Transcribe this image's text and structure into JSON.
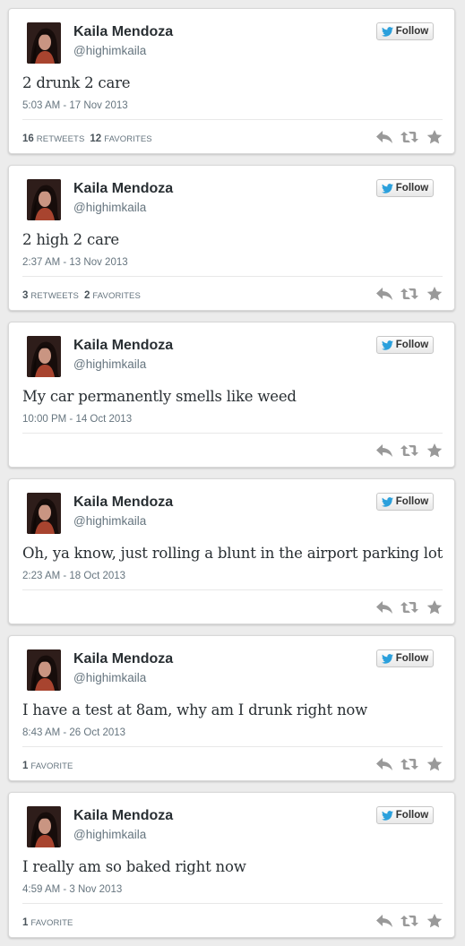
{
  "colors": {
    "page_background": "#ececec",
    "card_background": "#ffffff",
    "twitter_blue": "#2ba0dc",
    "action_icon_gray": "#999999"
  },
  "tweets": [
    {
      "display_name": "Kaila Mendoza",
      "handle": "@highimkaila",
      "follow_label": "Follow",
      "text": "2 drunk 2 care",
      "timestamp": "5:03 AM - 17 Nov 2013",
      "stats": [
        {
          "count": "16",
          "label": "RETWEETS"
        },
        {
          "count": "12",
          "label": "FAVORITES"
        }
      ]
    },
    {
      "display_name": "Kaila Mendoza",
      "handle": "@highimkaila",
      "follow_label": "Follow",
      "text": "2 high 2 care",
      "timestamp": "2:37 AM - 13 Nov 2013",
      "stats": [
        {
          "count": "3",
          "label": "RETWEETS"
        },
        {
          "count": "2",
          "label": "FAVORITES"
        }
      ]
    },
    {
      "display_name": "Kaila Mendoza",
      "handle": "@highimkaila",
      "follow_label": "Follow",
      "text": "My car permanently smells like weed",
      "timestamp": "10:00 PM - 14 Oct 2013",
      "stats": []
    },
    {
      "display_name": "Kaila Mendoza",
      "handle": "@highimkaila",
      "follow_label": "Follow",
      "text": "Oh, ya know, just rolling a blunt in the airport parking lot",
      "timestamp": "2:23 AM - 18 Oct 2013",
      "stats": []
    },
    {
      "display_name": "Kaila Mendoza",
      "handle": "@highimkaila",
      "follow_label": "Follow",
      "text": "I have a test at 8am, why am I drunk right now",
      "timestamp": "8:43 AM - 26 Oct 2013",
      "stats": [
        {
          "count": "1",
          "label": "FAVORITE"
        }
      ]
    },
    {
      "display_name": "Kaila Mendoza",
      "handle": "@highimkaila",
      "follow_label": "Follow",
      "text": "I really am so baked right now",
      "timestamp": "4:59 AM - 3 Nov 2013",
      "stats": [
        {
          "count": "1",
          "label": "FAVORITE"
        }
      ]
    }
  ],
  "icons": {
    "avatar": "profile-photo",
    "follow": "twitter-bird-icon",
    "reply": "reply-icon",
    "retweet": "retweet-icon",
    "favorite": "star-icon"
  }
}
